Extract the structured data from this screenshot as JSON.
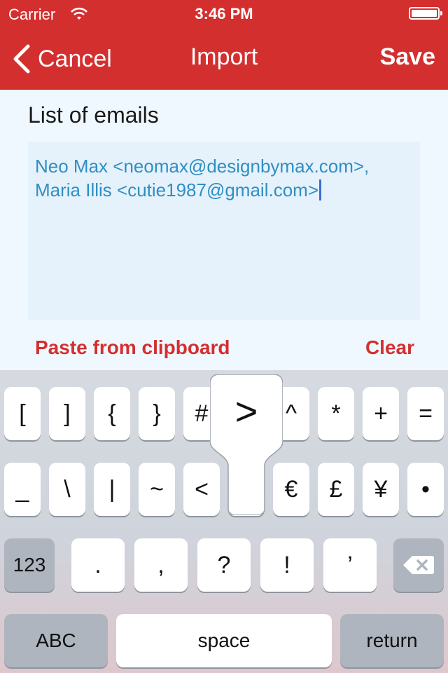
{
  "status_bar": {
    "carrier": "Carrier",
    "time": "3:46 PM"
  },
  "nav": {
    "back_label": "Cancel",
    "title": "Import",
    "save_label": "Save"
  },
  "form": {
    "section_label": "List of emails",
    "email_lines": [
      "Neo Max <neomax@designbymax.com>,",
      "Maria Illis <cutie1987@gmail.com>"
    ],
    "paste_label": "Paste from clipboard",
    "clear_label": "Clear"
  },
  "keyboard": {
    "row1": [
      "[",
      "]",
      "{",
      "}",
      "#",
      "%",
      "^",
      "*",
      "+",
      "="
    ],
    "row2": [
      "_",
      "\\",
      "|",
      "~",
      "<",
      ">",
      "€",
      "£",
      "¥",
      "•"
    ],
    "row3": [
      ".",
      ",",
      "?",
      "!",
      "’"
    ],
    "numbers_label": "123",
    "abc_label": "ABC",
    "space_label": "space",
    "return_label": "return",
    "popup_char": ">"
  },
  "colors": {
    "accent": "#d42f2f",
    "email_text": "#2f8fc2",
    "field_bg": "#e5f1fb"
  }
}
